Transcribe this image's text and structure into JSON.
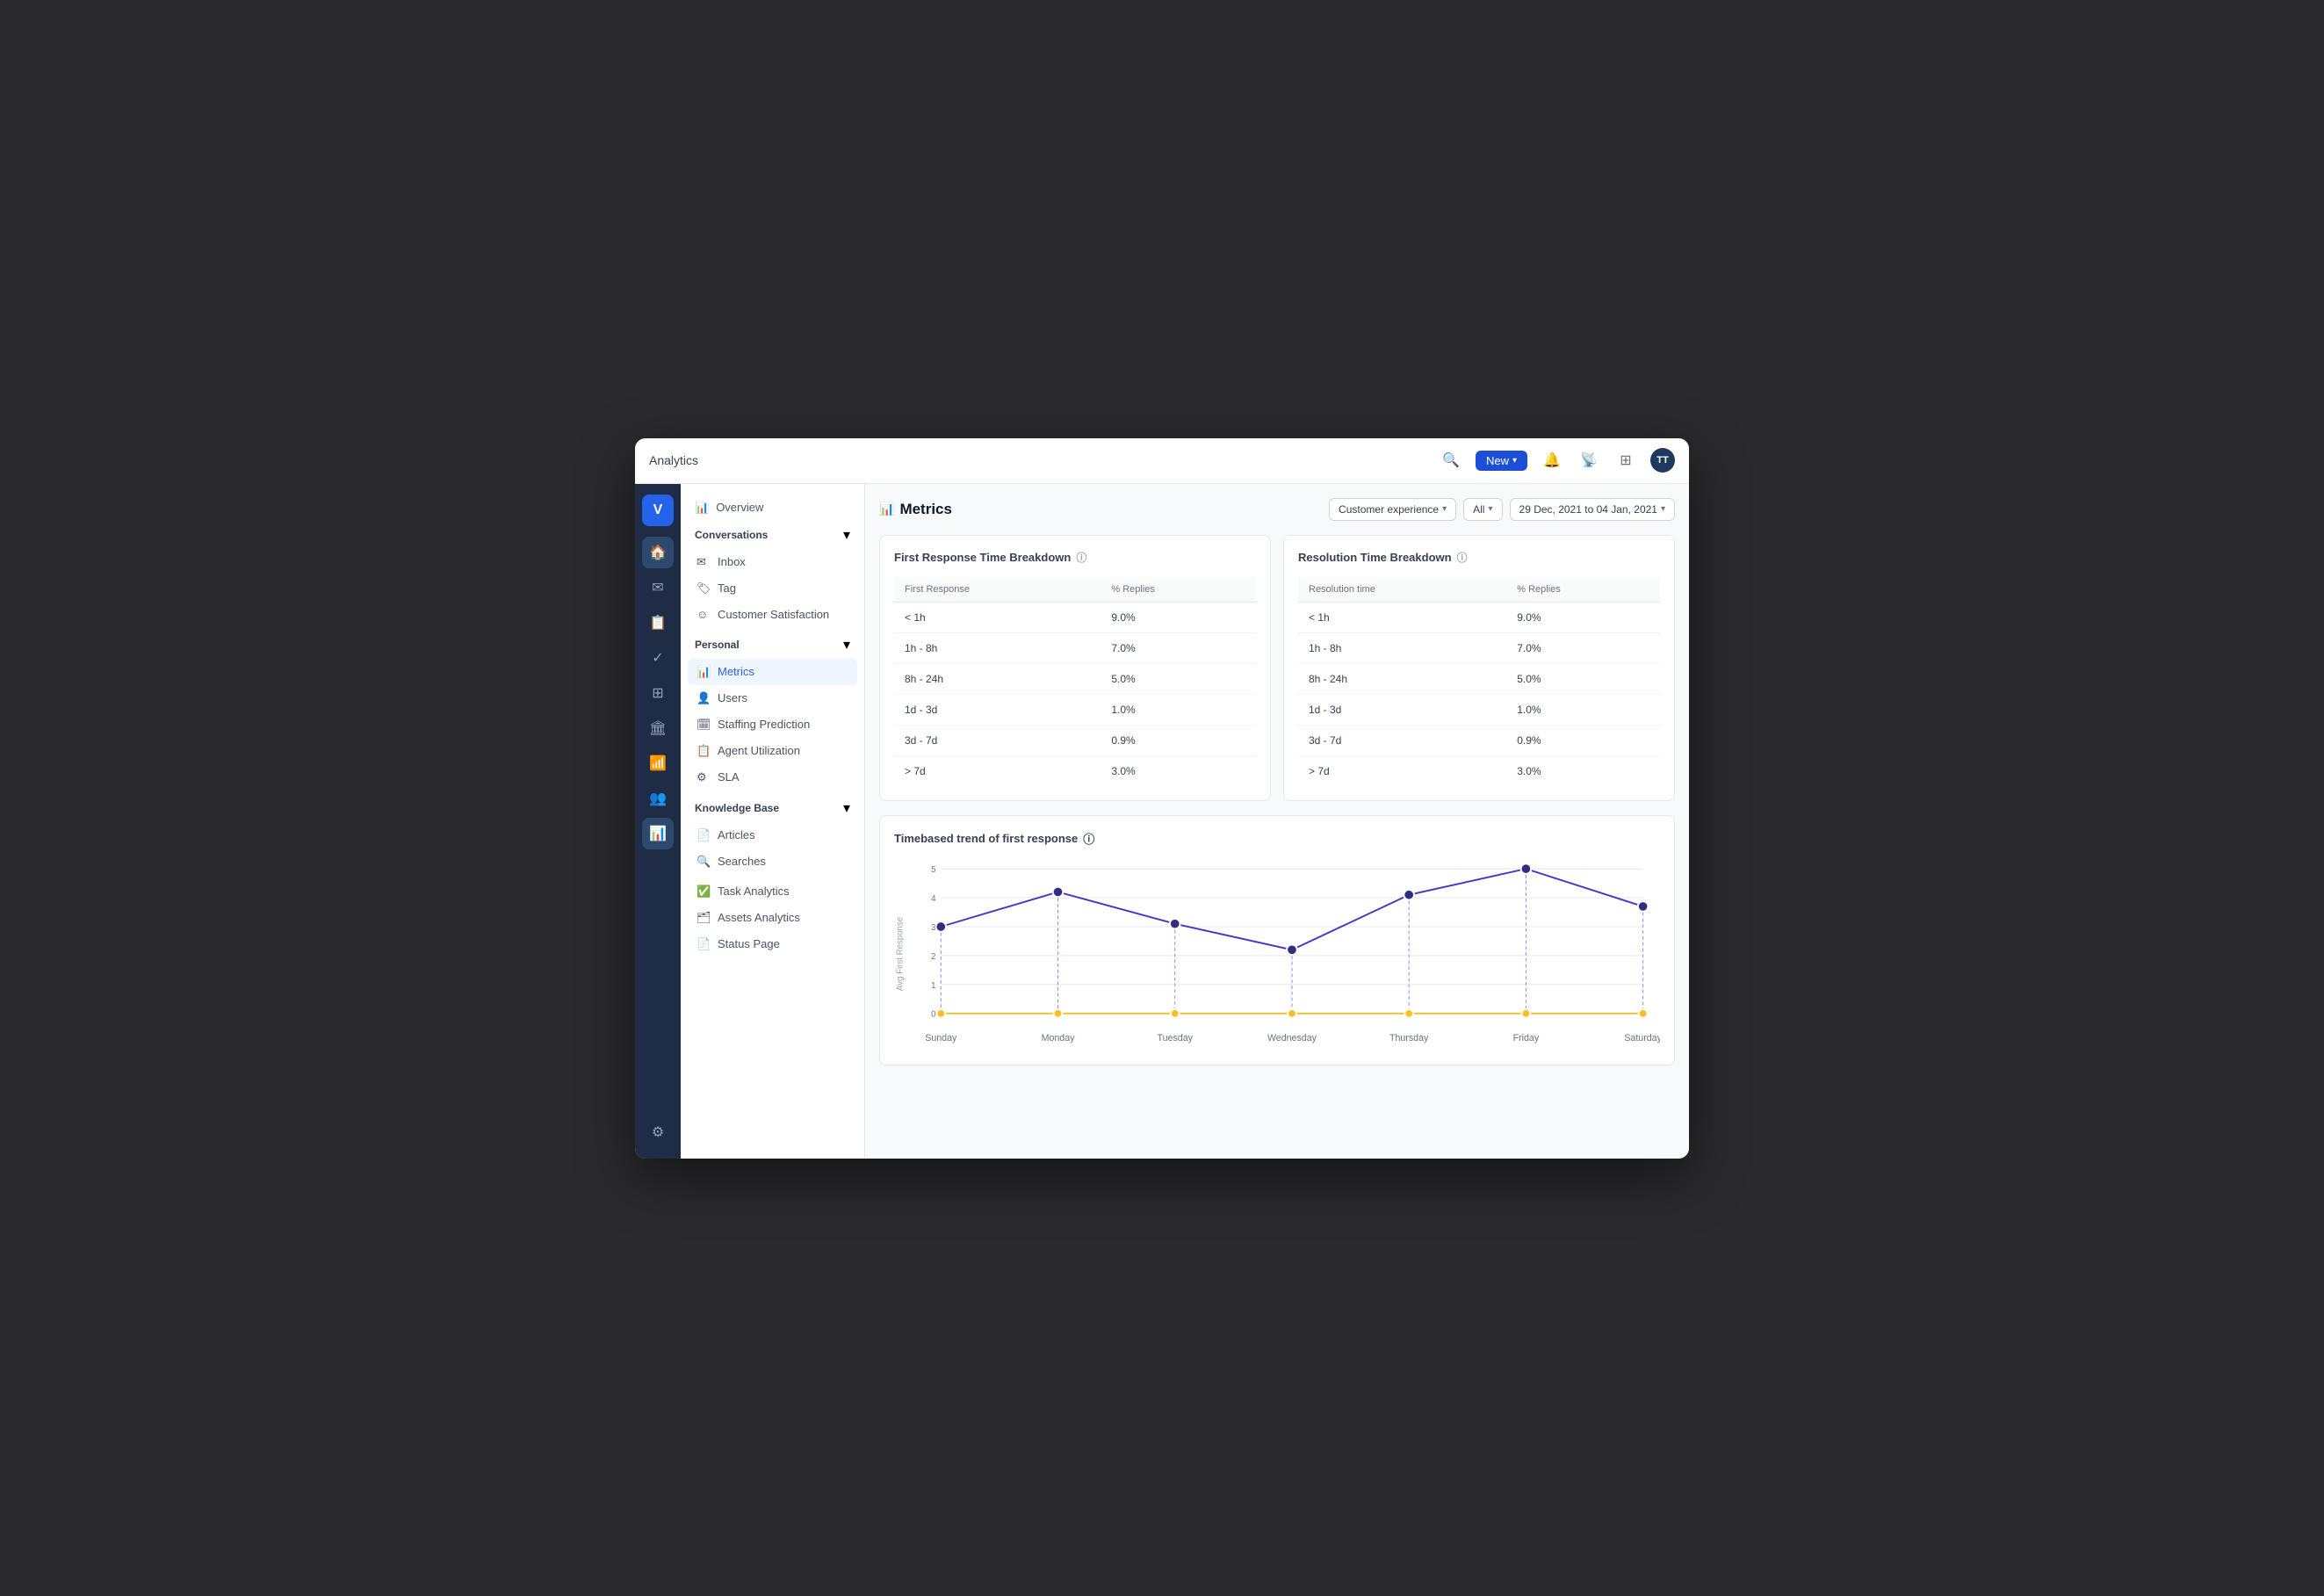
{
  "topbar": {
    "title": "Analytics",
    "new_label": "New",
    "avatar_text": "TT"
  },
  "sidebar": {
    "overview_label": "Overview",
    "conversations": {
      "label": "Conversations",
      "items": [
        {
          "label": "Inbox",
          "icon": "✉"
        },
        {
          "label": "Tag",
          "icon": "🏷"
        },
        {
          "label": "Customer Satisfaction",
          "icon": "☺"
        }
      ]
    },
    "personal": {
      "label": "Personal",
      "items": [
        {
          "label": "Metrics",
          "icon": "📊",
          "active": true
        },
        {
          "label": "Users",
          "icon": "👤"
        },
        {
          "label": "Staffing Prediction",
          "icon": "🗓"
        },
        {
          "label": "Agent Utilization",
          "icon": "📋"
        },
        {
          "label": "SLA",
          "icon": "⚙"
        }
      ]
    },
    "knowledge_base": {
      "label": "Knowledge Base",
      "items": [
        {
          "label": "Articles",
          "icon": "📄"
        },
        {
          "label": "Searches",
          "icon": "🔍"
        }
      ]
    },
    "other_items": [
      {
        "label": "Task Analytics",
        "icon": "✅"
      },
      {
        "label": "Assets Analytics",
        "icon": "🗂"
      },
      {
        "label": "Status Page",
        "icon": "📄"
      }
    ]
  },
  "content": {
    "title": "Metrics",
    "filters": {
      "experience": "Customer experience",
      "all": "All",
      "date_range": "29 Dec, 2021 to 04 Jan, 2021"
    },
    "first_response": {
      "title": "First Response Time Breakdown",
      "col1": "First Response",
      "col2": "% Replies",
      "rows": [
        {
          "range": "< 1h",
          "value": "9.0%"
        },
        {
          "range": "1h - 8h",
          "value": "7.0%"
        },
        {
          "range": "8h - 24h",
          "value": "5.0%"
        },
        {
          "range": "1d - 3d",
          "value": "1.0%"
        },
        {
          "range": "3d - 7d",
          "value": "0.9%"
        },
        {
          "range": "> 7d",
          "value": "3.0%"
        }
      ]
    },
    "resolution_time": {
      "title": "Resolution Time Breakdown",
      "col1": "Resolution time",
      "col2": "% Replies",
      "rows": [
        {
          "range": "< 1h",
          "value": "9.0%"
        },
        {
          "range": "1h - 8h",
          "value": "7.0%"
        },
        {
          "range": "8h - 24h",
          "value": "5.0%"
        },
        {
          "range": "1d - 3d",
          "value": "1.0%"
        },
        {
          "range": "3d - 7d",
          "value": "0.9%"
        },
        {
          "range": "> 7d",
          "value": "3.0%"
        }
      ]
    },
    "chart": {
      "title": "Timebased trend of first response",
      "y_labels": [
        "5",
        "4",
        "3",
        "2",
        "1",
        "0"
      ],
      "x_labels": [
        "Sunday",
        "Monday",
        "Tuesday",
        "Wednesday",
        "Thursday",
        "Friday",
        "Saturday"
      ],
      "points": [
        3,
        4.2,
        3.1,
        2.2,
        4.1,
        5,
        3.7
      ],
      "zero_points": [
        0,
        0,
        0,
        0,
        0,
        0,
        0
      ],
      "y_axis_label": "Avg First Response"
    }
  }
}
